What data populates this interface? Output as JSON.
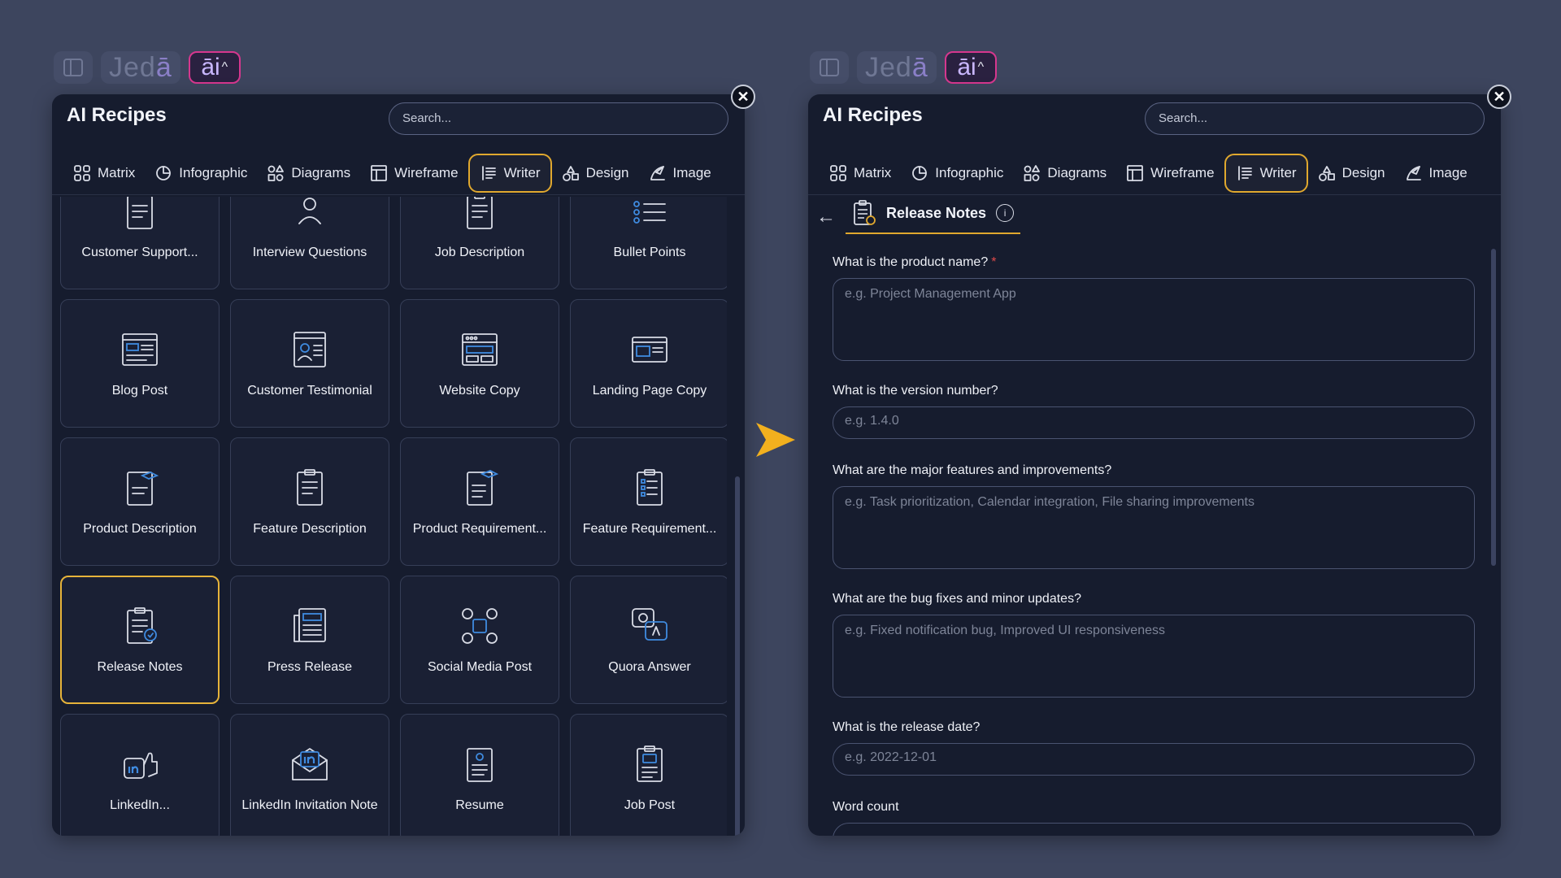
{
  "app": {
    "logo_text_1": "Jed",
    "logo_text_2": "ā",
    "ai_label": "āi",
    "ai_caret": "^"
  },
  "panel": {
    "title": "AI Recipes",
    "search_placeholder": "Search...",
    "close_label": "✕",
    "tabs": [
      {
        "label": "Matrix",
        "icon": "matrix-icon"
      },
      {
        "label": "Infographic",
        "icon": "infographic-icon"
      },
      {
        "label": "Diagrams",
        "icon": "diagrams-icon"
      },
      {
        "label": "Wireframe",
        "icon": "wireframe-icon"
      },
      {
        "label": "Writer",
        "icon": "writer-icon",
        "active": true
      },
      {
        "label": "Design",
        "icon": "design-icon"
      },
      {
        "label": "Image",
        "icon": "image-icon"
      }
    ]
  },
  "recipes": [
    {
      "label": "Customer Support...",
      "icon": "support-doc-icon"
    },
    {
      "label": "Interview Questions",
      "icon": "interview-icon"
    },
    {
      "label": "Job Description",
      "icon": "job-description-icon"
    },
    {
      "label": "Bullet Points",
      "icon": "bullet-points-icon"
    },
    {
      "label": "Blog Post",
      "icon": "blog-post-icon"
    },
    {
      "label": "Customer Testimonial",
      "icon": "testimonial-icon"
    },
    {
      "label": "Website Copy",
      "icon": "website-copy-icon"
    },
    {
      "label": "Landing Page Copy",
      "icon": "landing-page-icon"
    },
    {
      "label": "Product Description",
      "icon": "product-description-icon"
    },
    {
      "label": "Feature Description",
      "icon": "feature-description-icon"
    },
    {
      "label": "Product Requirement...",
      "icon": "product-requirement-icon"
    },
    {
      "label": "Feature Requirement...",
      "icon": "feature-requirement-icon"
    },
    {
      "label": "Release Notes",
      "icon": "release-notes-icon",
      "selected": true
    },
    {
      "label": "Press Release",
      "icon": "press-release-icon"
    },
    {
      "label": "Social Media Post",
      "icon": "social-media-icon"
    },
    {
      "label": "Quora Answer",
      "icon": "quora-answer-icon"
    },
    {
      "label": "LinkedIn...",
      "icon": "linkedin-thumb-icon"
    },
    {
      "label": "LinkedIn Invitation Note",
      "icon": "linkedin-invite-icon"
    },
    {
      "label": "Resume",
      "icon": "resume-icon"
    },
    {
      "label": "Job Post",
      "icon": "job-post-icon"
    }
  ],
  "release_form": {
    "back_label": "←",
    "title": "Release Notes",
    "info_label": "i",
    "fields": [
      {
        "question": "What is the product name?",
        "required_mark": "*",
        "placeholder": "e.g. Project Management App",
        "kind": "tall"
      },
      {
        "question": "What is the version number?",
        "required_mark": "",
        "placeholder": "e.g. 1.4.0",
        "kind": "short"
      },
      {
        "question": "What are the major features and improvements?",
        "required_mark": "",
        "placeholder": "e.g. Task prioritization, Calendar integration, File sharing improvements",
        "kind": "tall"
      },
      {
        "question": "What are the bug fixes and minor updates?",
        "required_mark": "",
        "placeholder": "e.g. Fixed notification bug, Improved UI responsiveness",
        "kind": "tall"
      },
      {
        "question": "What is the release date?",
        "required_mark": "",
        "placeholder": "e.g. 2022-12-01",
        "kind": "short"
      },
      {
        "question": "Word count",
        "required_mark": "",
        "placeholder": "",
        "kind": "short"
      }
    ]
  },
  "colors": {
    "accent": "#e0a82e",
    "arrow": "#f2b01e",
    "ai_border": "#d6378e",
    "background": "#3d455e",
    "panel": "#161c2e"
  }
}
